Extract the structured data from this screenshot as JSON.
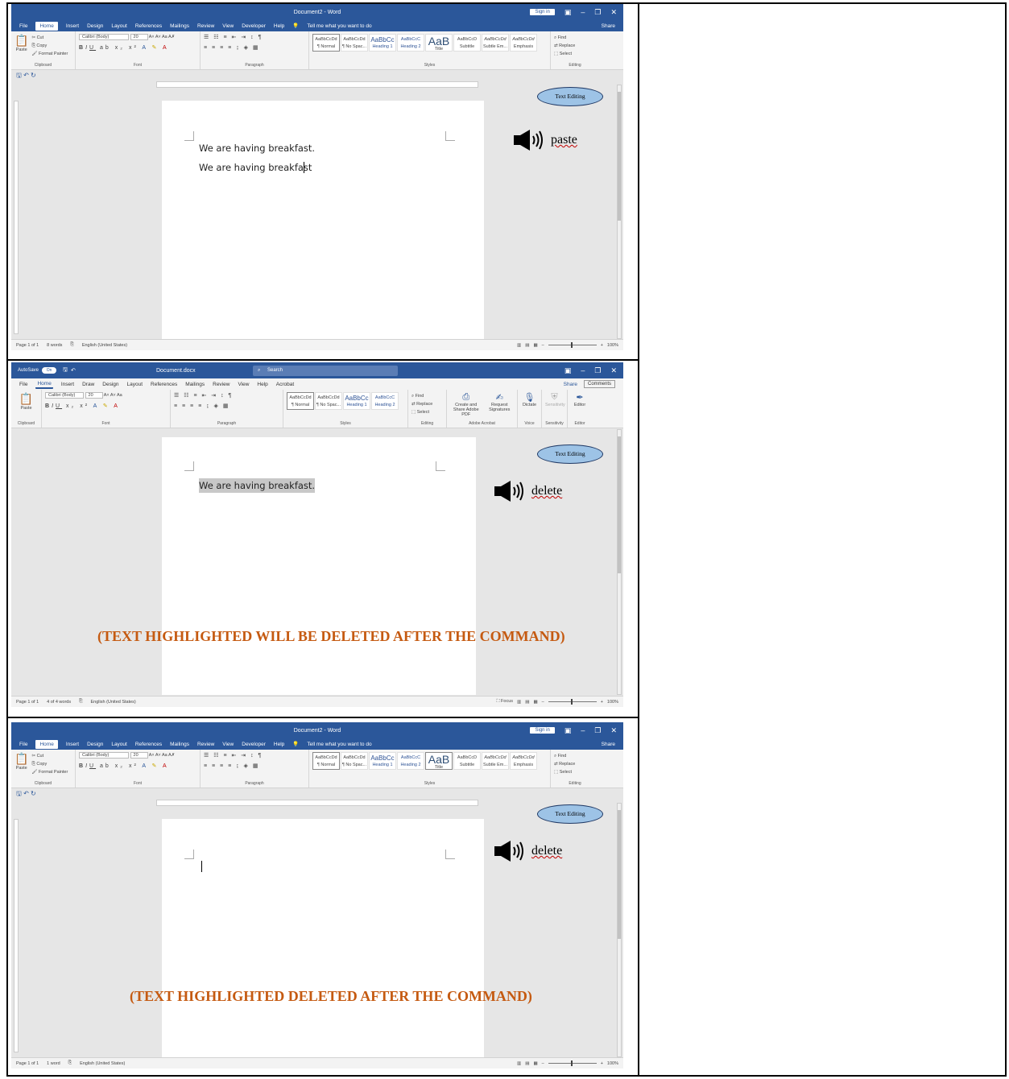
{
  "colors": {
    "word_blue": "#2b579a",
    "caption_orange": "#c55a11",
    "badge_fill": "#9dc3e6",
    "highlight_gray": "#c8c8c8"
  },
  "panel1": {
    "window_title": "Document2 - Word",
    "sign_in": "Sign in",
    "share": "Share",
    "tabs": [
      "File",
      "Home",
      "Insert",
      "Design",
      "Layout",
      "References",
      "Mailings",
      "Review",
      "View",
      "Developer",
      "Help"
    ],
    "tell_me": "Tell me what you want to do",
    "ribbon": {
      "paste": "Paste",
      "cut": "Cut",
      "copy": "Copy",
      "format_painter": "Format Painter",
      "font_name": "Calibri (Body)",
      "font_size": "20",
      "styles": [
        "AaBbCcDd",
        "AaBbCcDd",
        "AaBbCc",
        "AaBbCcC",
        "AaB",
        "AaBbCcD",
        "AaBbCcDd",
        "AaBbCcDd"
      ],
      "style_names": [
        "¶ Normal",
        "¶ No Spac...",
        "Heading 1",
        "Heading 2",
        "Title",
        "Subtitle",
        "Subtle Em...",
        "Emphasis"
      ],
      "find": "Find",
      "replace": "Replace",
      "select": "Select",
      "groups": [
        "Clipboard",
        "Font",
        "Paragraph",
        "Styles",
        "Editing"
      ]
    },
    "doc_lines": [
      "We are having breakfast.",
      "We are having breakfast"
    ],
    "status": {
      "page": "Page 1 of 1",
      "words": "8 words",
      "language": "English (United States)",
      "zoom": "100%"
    },
    "badge": "Text Editing",
    "command": "paste"
  },
  "panel2": {
    "autosave": "AutoSave",
    "autosave_state": "On",
    "window_title": "Document.docx",
    "search": "Search",
    "tabs": [
      "File",
      "Home",
      "Insert",
      "Draw",
      "Design",
      "Layout",
      "References",
      "Mailings",
      "Review",
      "View",
      "Help",
      "Acrobat"
    ],
    "share": "Share",
    "comments": "Comments",
    "ribbon": {
      "paste": "Paste",
      "font_name": "Calibri (Body)",
      "font_size": "20",
      "styles": [
        "AaBbCcDd",
        "AaBbCcDd",
        "AaBbCc",
        "AaBbCcC"
      ],
      "style_names": [
        "¶ Normal",
        "¶ No Spac...",
        "Heading 1",
        "Heading 2"
      ],
      "find": "Find",
      "replace": "Replace",
      "select": "Select",
      "acrobat": [
        "Create and Share Adobe PDF",
        "Request Signatures"
      ],
      "voice": "Dictate",
      "sensitivity": "Sensitivity",
      "editor": "Editor",
      "groups": [
        "Clipboard",
        "Font",
        "Paragraph",
        "Styles",
        "Editing",
        "Adobe Acrobat",
        "Voice",
        "Sensitivity",
        "Editor"
      ]
    },
    "doc_lines": [
      "We are having breakfast."
    ],
    "status": {
      "page": "Page 1 of 1",
      "words": "4 of 4 words",
      "language": "English (United States)",
      "focus": "Focus",
      "zoom": "100%"
    },
    "badge": "Text Editing",
    "command": "delete",
    "caption": "(TEXT HIGHLIGHTED WILL BE DELETED AFTER THE COMMAND)"
  },
  "panel3": {
    "window_title": "Document2 - Word",
    "sign_in": "Sign in",
    "share": "Share",
    "tabs": [
      "File",
      "Home",
      "Insert",
      "Design",
      "Layout",
      "References",
      "Mailings",
      "Review",
      "View",
      "Developer",
      "Help"
    ],
    "tell_me": "Tell me what you want to do",
    "ribbon": {
      "paste": "Paste",
      "cut": "Cut",
      "copy": "Copy",
      "format_painter": "Format Painter",
      "font_name": "Calibri (Body)",
      "font_size": "20",
      "styles": [
        "AaBbCcDd",
        "AaBbCcDd",
        "AaBbCc",
        "AaBbCcC",
        "AaB",
        "AaBbCcD",
        "AaBbCcDd",
        "AaBbCcDd"
      ],
      "style_names": [
        "¶ Normal",
        "¶ No Spac...",
        "Heading 1",
        "Heading 2",
        "Title",
        "Subtitle",
        "Subtle Em...",
        "Emphasis"
      ],
      "find": "Find",
      "replace": "Replace",
      "select": "Select",
      "groups": [
        "Clipboard",
        "Font",
        "Paragraph",
        "Styles",
        "Editing"
      ]
    },
    "status": {
      "page": "Page 1 of 1",
      "words": "1 word",
      "language": "English (United States)",
      "zoom": "100%"
    },
    "badge": "Text Editing",
    "command": "delete",
    "caption": "(TEXT HIGHLIGHTED DELETED AFTER THE COMMAND)"
  }
}
